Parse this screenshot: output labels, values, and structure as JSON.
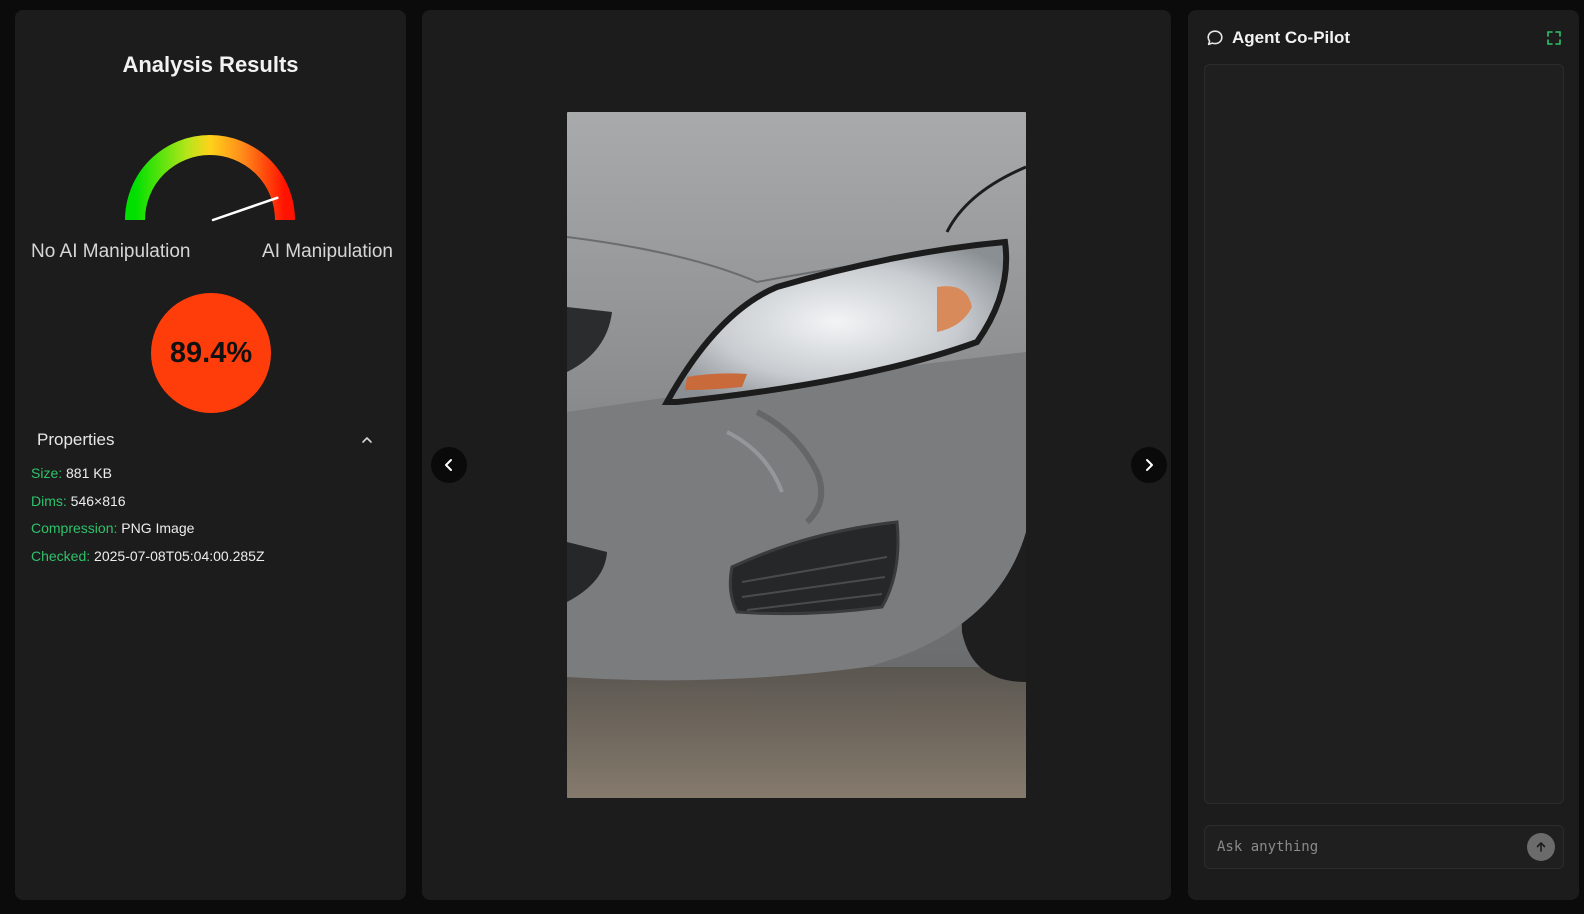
{
  "left": {
    "title": "Analysis Results",
    "gauge": {
      "value_percent": 89.4,
      "left_label": "No AI Manipulation",
      "right_label": "AI Manipulation"
    },
    "score_text": "89.4%",
    "score_color": "#ff3d0a",
    "properties": {
      "header": "Properties",
      "items": [
        {
          "key": "Size:",
          "value": "881 KB"
        },
        {
          "key": "Dims:",
          "value": "546×816"
        },
        {
          "key": "Compression:",
          "value": "PNG Image"
        },
        {
          "key": "Checked:",
          "value": "2025-07-08T05:04:00.285Z"
        }
      ]
    }
  },
  "center": {
    "image_subject": "damaged silver car front bumper and headlight",
    "prev_icon": "chevron-left-icon",
    "next_icon": "chevron-right-icon"
  },
  "right": {
    "title": "Agent Co-Pilot",
    "chat_icon": "chat-bubble-icon",
    "expand_icon": "expand-icon",
    "input_placeholder": "Ask anything",
    "send_icon": "arrow-up-icon"
  },
  "colors": {
    "accent_green": "#2fc26b",
    "panel_bg": "#1c1c1c",
    "page_bg": "#0b0b0b"
  }
}
